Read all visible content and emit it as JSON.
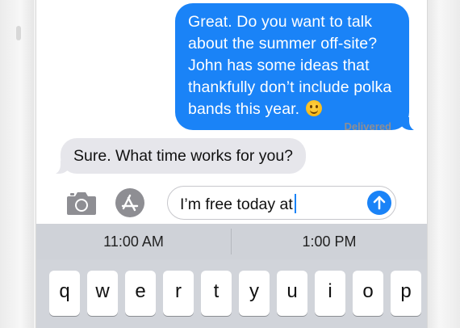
{
  "conversation": {
    "outgoing_message": "Great. Do you want to talk about the summer off-site? John has some ideas that thankfully don’t include polka bands this year.",
    "emoji": "smiling-face",
    "delivery_status": "Delivered",
    "incoming_message": "Sure. What time works for you?"
  },
  "composer": {
    "input_value": "I’m free today at",
    "camera_icon": "camera-icon",
    "apps_icon": "app-store-icon",
    "send_icon": "arrow-up-icon"
  },
  "keyboard": {
    "suggestions": [
      "11:00 AM",
      "1:00 PM"
    ],
    "row1": [
      "q",
      "w",
      "e",
      "r",
      "t",
      "y",
      "u",
      "i",
      "o",
      "p"
    ]
  },
  "colors": {
    "outgoing_bubble": "#1a83f7",
    "incoming_bubble": "#e6e6eb",
    "keyboard_bg": "#d1d4da"
  }
}
